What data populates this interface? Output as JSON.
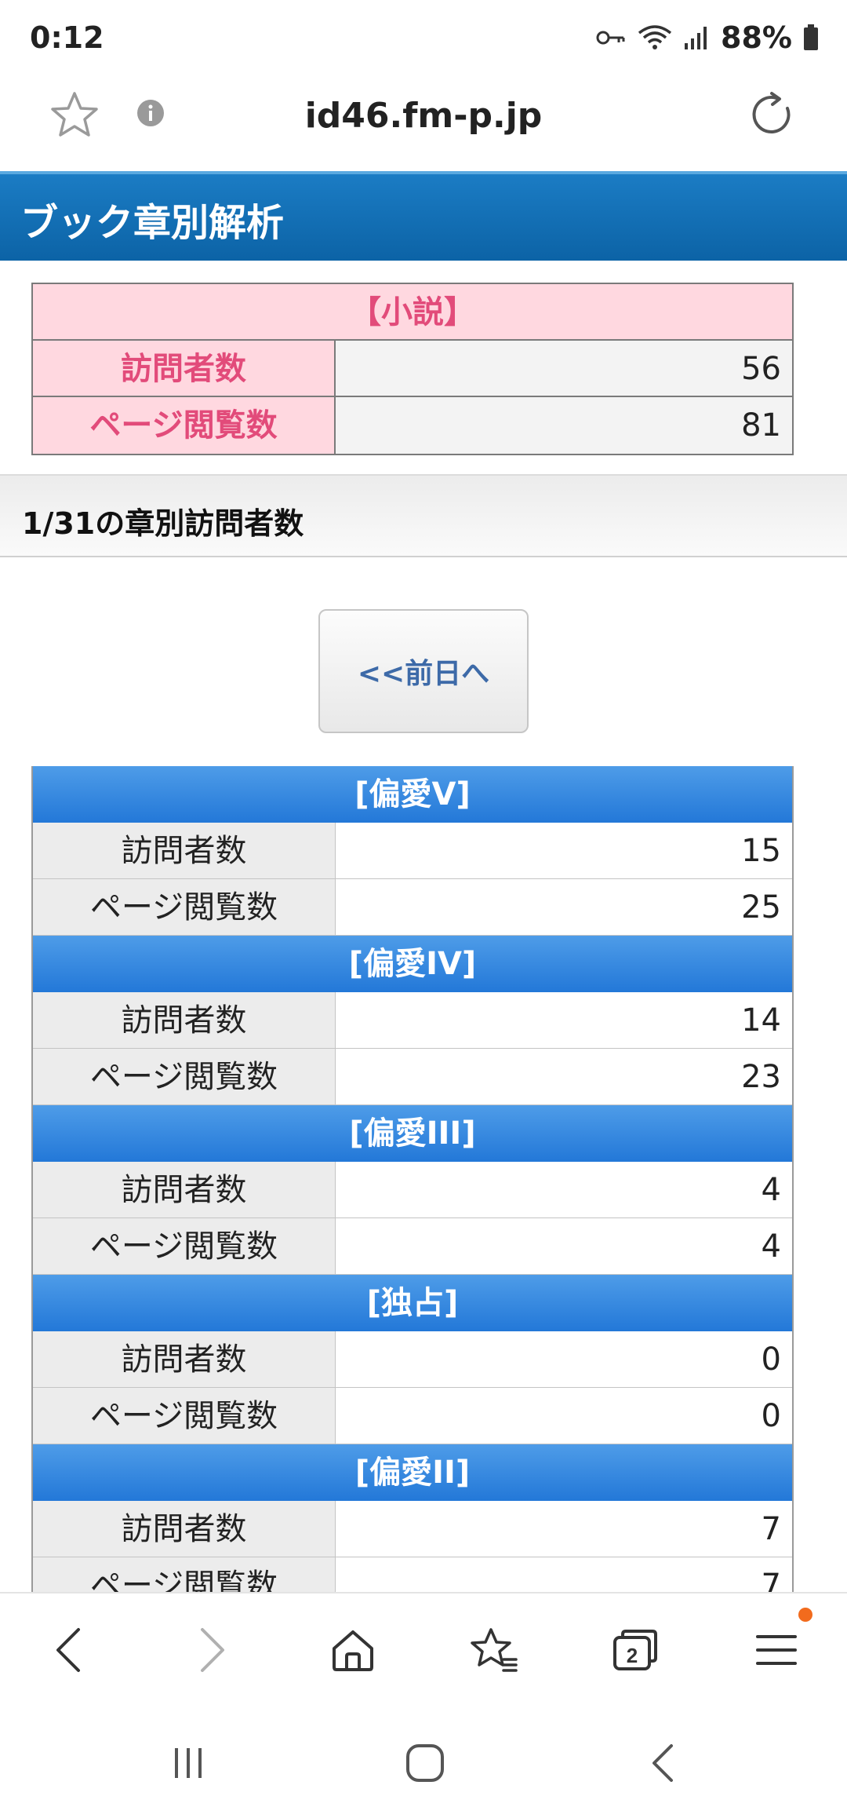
{
  "status_bar": {
    "time": "0:12",
    "battery": "88%",
    "icons": [
      "key-icon",
      "wifi-icon",
      "signal-icon",
      "battery-icon"
    ]
  },
  "url_bar": {
    "url": "id46.fm-p.jp",
    "icons": [
      "star-icon",
      "info-icon",
      "reload-icon"
    ]
  },
  "header": {
    "title": "ブック章別解析",
    "color": "#0c63a6"
  },
  "summary": {
    "title": "【小説】",
    "rows": [
      {
        "label": "訪問者数",
        "value": "56"
      },
      {
        "label": "ページ閲覧数",
        "value": "81"
      }
    ],
    "accent_color": "#e24b7a"
  },
  "section": {
    "title": "1/31の章別訪問者数"
  },
  "prev_button": {
    "label": "<<前日へ"
  },
  "chapters": [
    {
      "title": "[偏愛V]",
      "visitors_label": "訪問者数",
      "visitors": "15",
      "views_label": "ページ閲覧数",
      "views": "25"
    },
    {
      "title": "[偏愛IV]",
      "visitors_label": "訪問者数",
      "visitors": "14",
      "views_label": "ページ閲覧数",
      "views": "23"
    },
    {
      "title": "[偏愛III]",
      "visitors_label": "訪問者数",
      "visitors": "4",
      "views_label": "ページ閲覧数",
      "views": "4"
    },
    {
      "title": "[独占]",
      "visitors_label": "訪問者数",
      "visitors": "0",
      "views_label": "ページ閲覧数",
      "views": "0"
    },
    {
      "title": "[偏愛II]",
      "visitors_label": "訪問者数",
      "visitors": "7",
      "views_label": "ページ閲覧数",
      "views": "7"
    }
  ],
  "toolbar": {
    "icons": [
      "back-icon",
      "forward-icon",
      "home-icon",
      "bookmarks-icon",
      "tabs-icon",
      "menu-icon"
    ],
    "tab_count": "2"
  },
  "navbar": {
    "icons": [
      "recents-icon",
      "home-nav-icon",
      "back-nav-icon"
    ]
  }
}
